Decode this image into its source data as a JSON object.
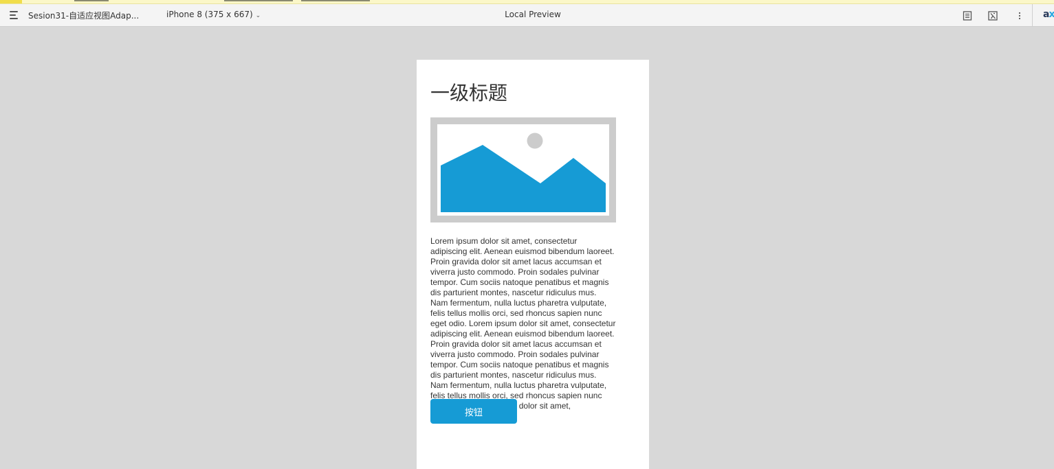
{
  "toolbar": {
    "page_name": "Sesion31-自适应视图Adap...",
    "device_label": "iPhone 8 (375 x 667)",
    "title": "Local Preview",
    "brand_a": "a",
    "brand_x": "x",
    "icons": [
      "menu-icon",
      "chevron-down-icon",
      "notes-icon",
      "inspect-icon",
      "more-options-icon"
    ]
  },
  "page": {
    "heading": "一级标题",
    "image_icon": "image-placeholder-icon",
    "paragraph": "Lorem ipsum dolor sit amet, consectetur adipiscing elit. Aenean euismod bibendum laoreet. Proin gravida dolor sit amet lacus accumsan et viverra justo commodo. Proin sodales pulvinar tempor. Cum sociis natoque penatibus et magnis dis parturient montes, nascetur ridiculus mus. Nam fermentum, nulla luctus pharetra vulputate, felis tellus mollis orci, sed rhoncus sapien nunc eget odio. Lorem ipsum dolor sit amet, consectetur adipiscing elit. Aenean euismod bibendum laoreet. Proin gravida dolor sit amet lacus accumsan et viverra justo commodo. Proin sodales pulvinar tempor. Cum sociis natoque penatibus et magnis dis parturient montes, nascetur ridiculus mus. Nam fermentum, nulla luctus pharetra vulputate, felis tellus mollis orci, sed rhoncus sapien nunc eget odio. Lorem ipsum dolor sit amet,",
    "button_label": "按钮"
  },
  "colors": {
    "canvas_bg": "#d8d8d8",
    "accent": "#169bd5",
    "placeholder_frame": "#cccccc"
  }
}
